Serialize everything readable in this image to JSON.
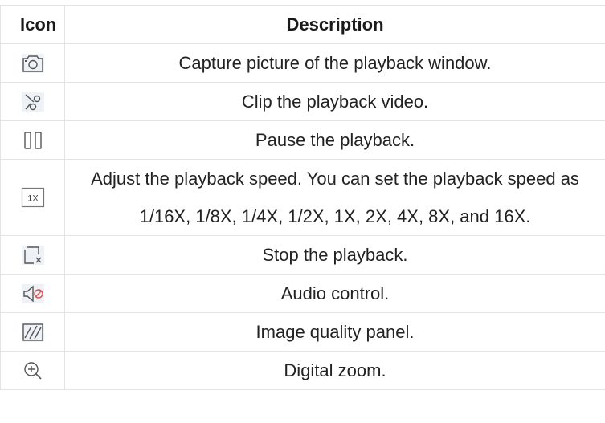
{
  "table": {
    "headers": {
      "icon": "Icon",
      "description": "Description"
    },
    "rows": [
      {
        "icon": "camera-icon",
        "description": "Capture picture of the playback window."
      },
      {
        "icon": "scissors-icon",
        "description": "Clip the playback video."
      },
      {
        "icon": "pause-icon",
        "description": "Pause the playback."
      },
      {
        "icon": "speed-1x-icon",
        "icon_text": "1X",
        "description": "Adjust the playback speed. You can set the playback speed as 1/16X, 1/8X, 1/4X, 1/2X, 1X, 2X, 4X, 8X, and 16X."
      },
      {
        "icon": "stop-icon",
        "description": "Stop the playback."
      },
      {
        "icon": "audio-muted-icon",
        "description": "Audio control."
      },
      {
        "icon": "image-quality-icon",
        "description": "Image quality panel."
      },
      {
        "icon": "zoom-in-icon",
        "description": "Digital zoom."
      }
    ]
  },
  "colors": {
    "icon_stroke": "#555555",
    "icon_bg": "#eef1f6",
    "border": "#e4e4e4"
  }
}
